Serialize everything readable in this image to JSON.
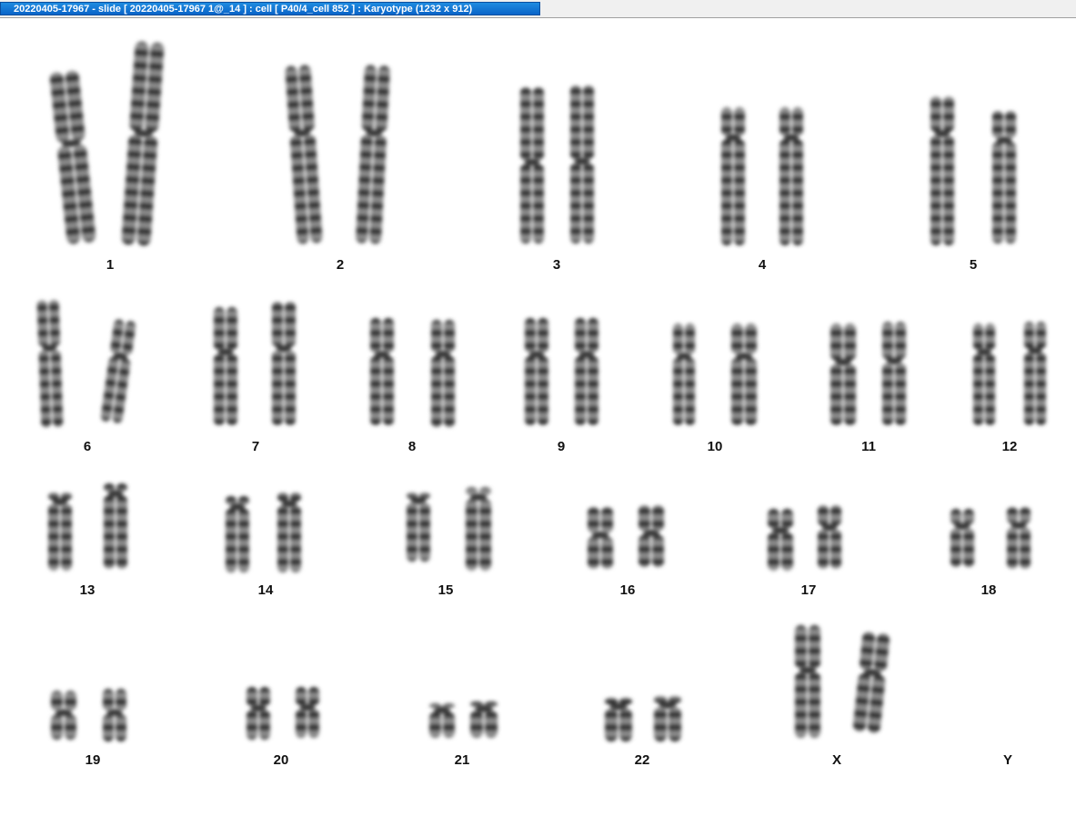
{
  "window": {
    "title": "20220405-17967 - slide [ 20220405-17967 1@_14 ] : cell [ P40/4_cell 852 ] : Karyotype  (1232 x 912)"
  },
  "colors": {
    "title_bar": "#0a64c8",
    "title_text": "#ffffff",
    "background": "#ffffff",
    "chromosome": "#3a3a3a"
  },
  "karyotype": {
    "labels": {
      "c1": "1",
      "c2": "2",
      "c3": "3",
      "c4": "4",
      "c5": "5",
      "c6": "6",
      "c7": "7",
      "c8": "8",
      "c9": "9",
      "c10": "10",
      "c11": "11",
      "c12": "12",
      "c13": "13",
      "c14": "14",
      "c15": "15",
      "c16": "16",
      "c17": "17",
      "c18": "18",
      "c19": "19",
      "c20": "20",
      "c21": "21",
      "c22": "22",
      "cX": "X",
      "cY": "Y"
    }
  }
}
